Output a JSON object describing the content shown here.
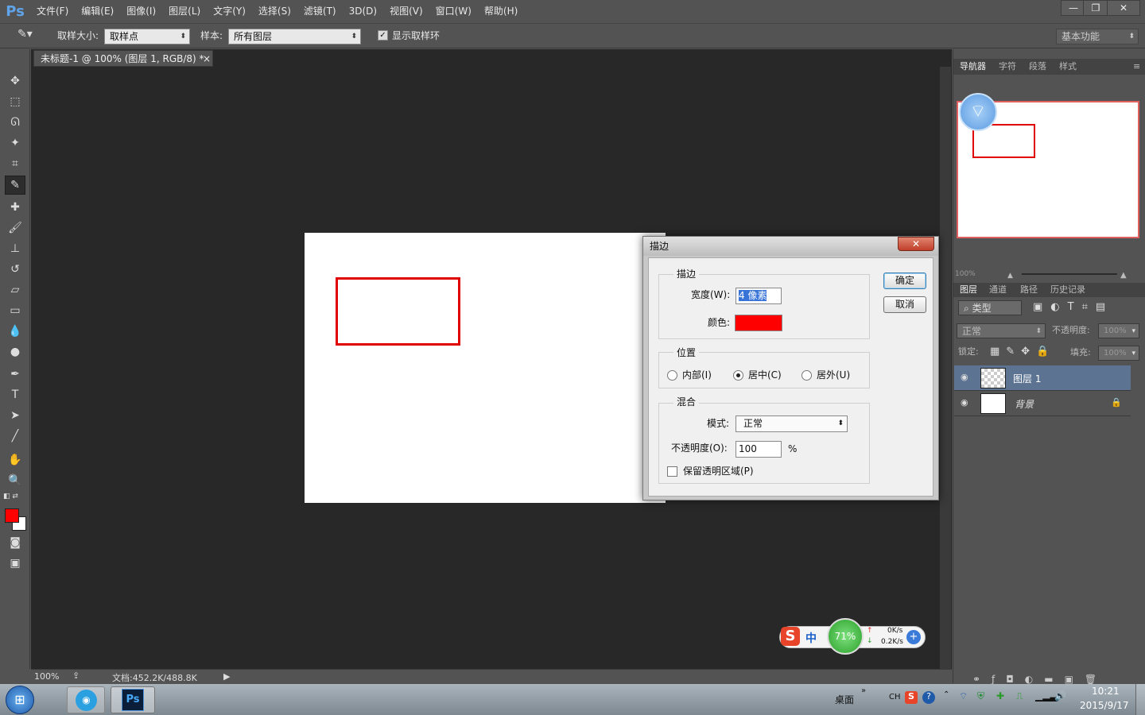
{
  "app": {
    "logo": "Ps"
  },
  "menu": [
    "文件(F)",
    "编辑(E)",
    "图像(I)",
    "图层(L)",
    "文字(Y)",
    "选择(S)",
    "滤镜(T)",
    "3D(D)",
    "视图(V)",
    "窗口(W)",
    "帮助(H)"
  ],
  "window_buttons": {
    "minimize": "—",
    "restore": "❐",
    "close": "✕"
  },
  "options": {
    "sample_size_label": "取样大小:",
    "sample_size_value": "取样点",
    "sample_label": "样本:",
    "sample_value": "所有图层",
    "show_ring_label": "显示取样环",
    "show_ring_checked": true,
    "workspace": "基本功能"
  },
  "document": {
    "tab_title": "未标题-1 @ 100% (图层 1, RGB/8) *",
    "tab_close": "×"
  },
  "status": {
    "zoom": "100%",
    "doc_info": "文档:452.2K/488.8K"
  },
  "colors": {
    "foreground": "#ff0000",
    "background": "#ffffff",
    "stroke": "#e00000"
  },
  "right_panel": {
    "top_tabs": [
      "导航器",
      "字符",
      "段落",
      "样式"
    ],
    "nav_zoom": "100%",
    "layer_tabs": [
      "图层",
      "通道",
      "路径",
      "历史记录"
    ],
    "filter_label": "类型",
    "blend_mode": "正常",
    "opacity_label": "不透明度:",
    "opacity_value": "100%",
    "lock_label": "锁定:",
    "fill_label": "填充:",
    "fill_value": "100%",
    "layers": [
      {
        "name": "图层 1",
        "selected": true
      },
      {
        "name": "背景",
        "selected": false,
        "locked": true
      }
    ]
  },
  "dialog": {
    "title": "描边",
    "stroke_group": "描边",
    "width_label": "宽度(W):",
    "width_value": "4 像素",
    "color_label": "颜色:",
    "color_value": "#ff0000",
    "position_group": "位置",
    "pos_inside": "内部(I)",
    "pos_center": "居中(C)",
    "pos_outside": "居外(U)",
    "position_selected": "居中(C)",
    "blend_group": "混合",
    "mode_label": "模式:",
    "mode_value": "正常",
    "opacity_label": "不透明度(O):",
    "opacity_value": "100",
    "opacity_unit": "%",
    "preserve_label": "保留透明区域(P)",
    "preserve_checked": false,
    "ok": "确定",
    "cancel": "取消"
  },
  "speed_widget": {
    "ime": "中",
    "percent": "71%",
    "up": "0K/s",
    "down": "0.2K/s"
  },
  "taskbar": {
    "desktop": "桌面",
    "lang": "CH",
    "time": "10:21",
    "date": "2015/9/17",
    "ps_icon": "Ps"
  }
}
